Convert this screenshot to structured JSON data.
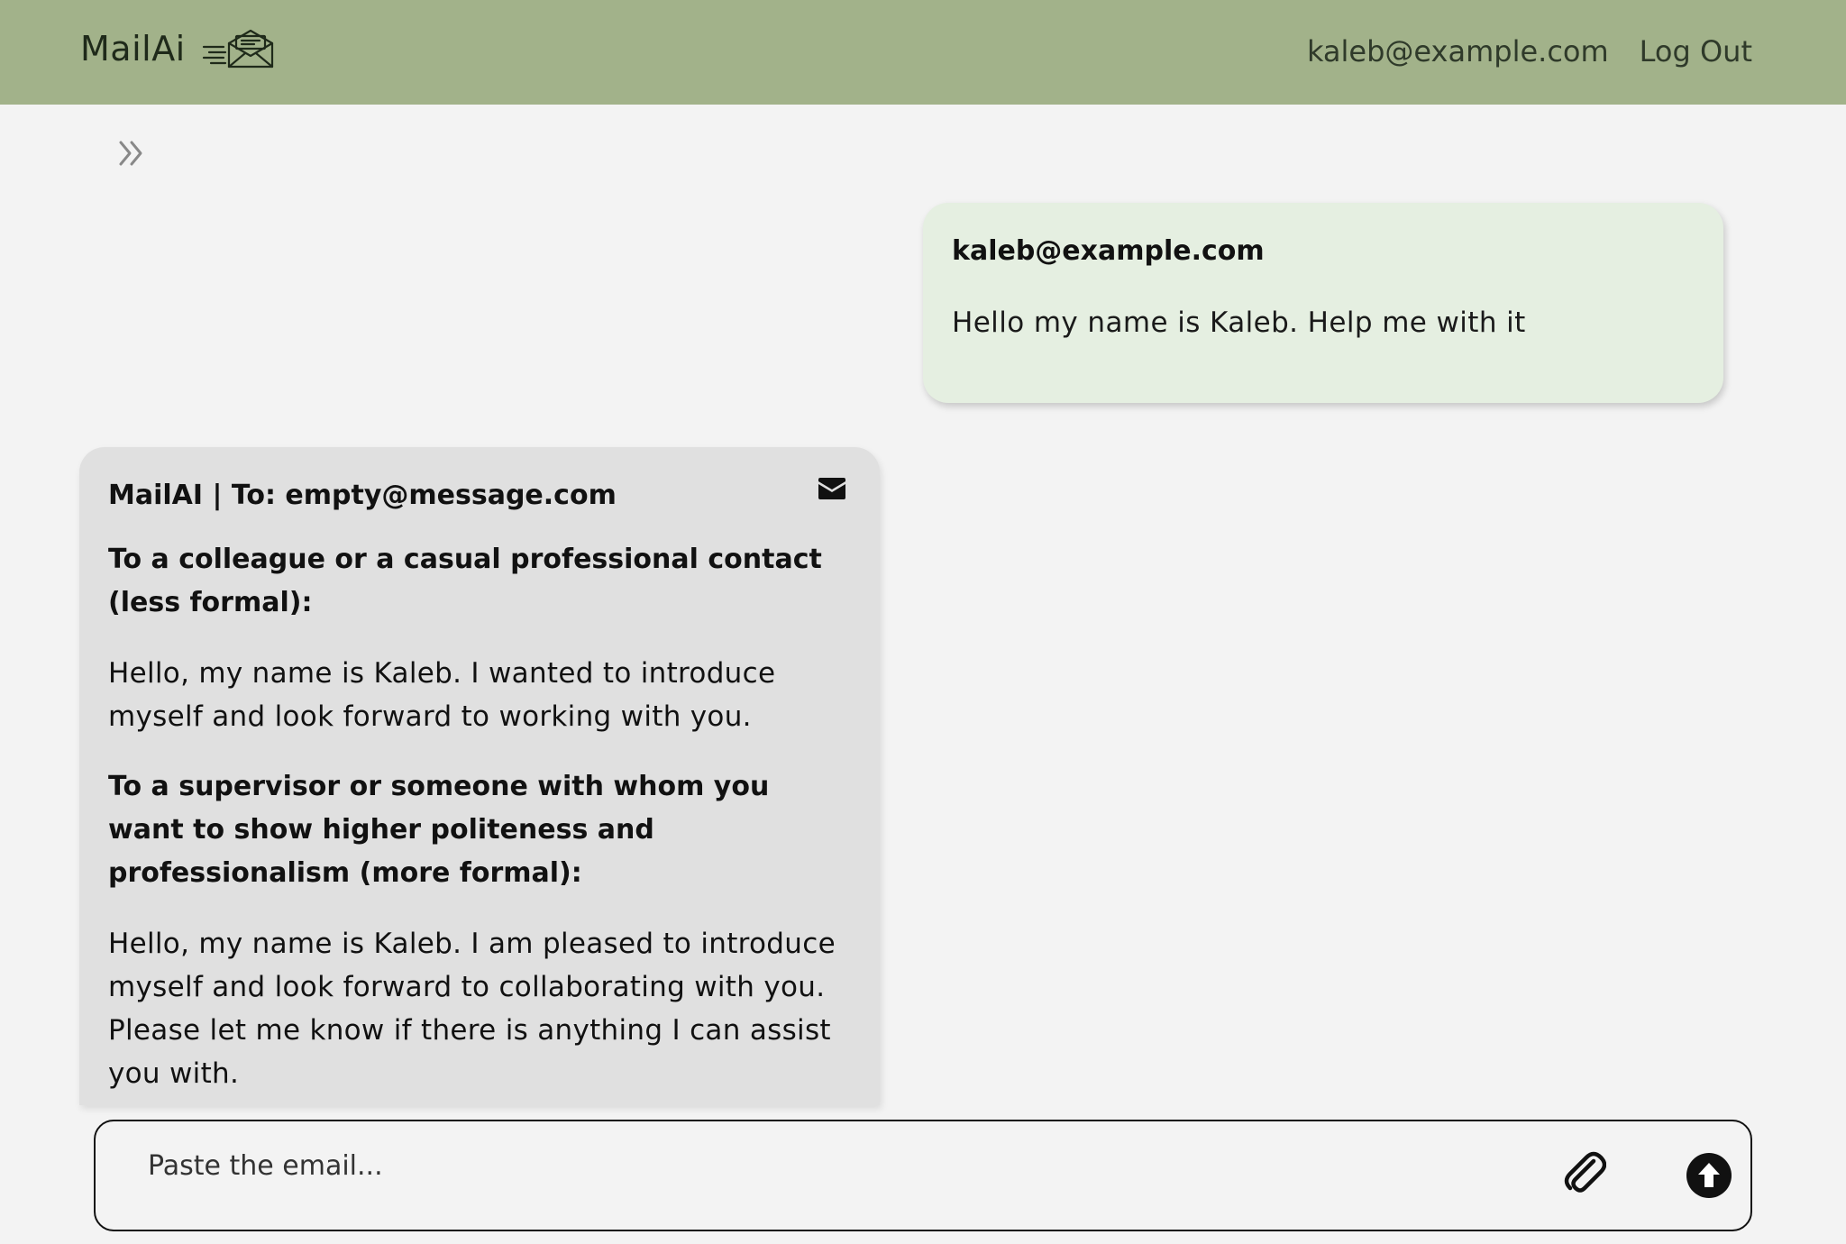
{
  "header": {
    "brand": "MailAi",
    "user_email": "kaleb@example.com",
    "logout_label": "Log Out"
  },
  "icons": {
    "logo": "envelope-speed-icon",
    "sidebar_toggle": "chevron-double-right-icon",
    "mail": "envelope-icon",
    "attach": "paperclip-icon",
    "send": "arrow-up-circle-icon"
  },
  "colors": {
    "header_bg": "#a2b28a",
    "page_bg": "#f3f3f3",
    "user_bubble_bg": "#e5efe1",
    "ai_bubble_bg": "#e0e0e0"
  },
  "messages": {
    "user": {
      "sender": "kaleb@example.com",
      "text": "Hello my name is Kaleb. Help me with it"
    },
    "ai": {
      "header": "MailAI | To: empty@message.com",
      "sections": [
        {
          "title": "To a colleague or a casual professional contact (less formal):",
          "body": "Hello, my name is Kaleb. I wanted to introduce myself and look forward to working with you."
        },
        {
          "title": "To a supervisor or someone with whom you want to show higher politeness and professionalism (more formal):",
          "body": "Hello, my name is Kaleb. I am pleased to introduce myself and look forward to collaborating with you. Please let me know if there is anything I can assist you with."
        }
      ]
    }
  },
  "composer": {
    "placeholder": "Paste the email...",
    "value": ""
  }
}
